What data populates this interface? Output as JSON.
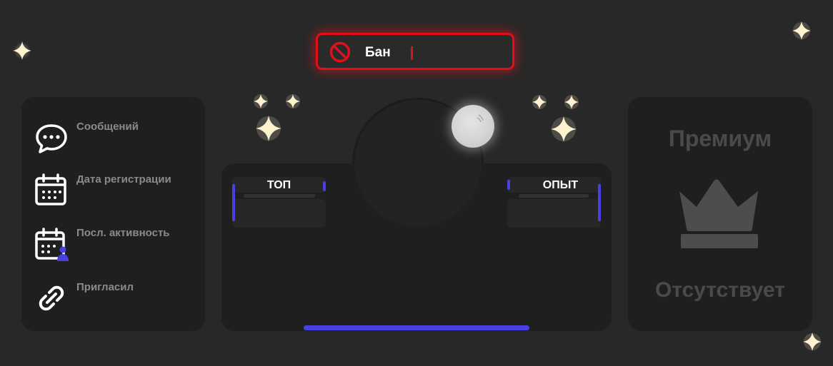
{
  "ban": {
    "label": "Бан",
    "status_color": "#e0101a"
  },
  "stats": [
    {
      "label": "Сообщений",
      "icon": "chat-bubble-icon"
    },
    {
      "label": "Дата регистрации",
      "icon": "calendar-icon"
    },
    {
      "label": "Посл. активность",
      "icon": "calendar-user-icon"
    },
    {
      "label": "Пригласил",
      "icon": "link-icon"
    }
  ],
  "profile": {
    "top_label": "ТОП",
    "xp_label": "ОПЫТ",
    "accent_color": "#4a3fe0"
  },
  "premium": {
    "title": "Премиум",
    "status": "Отсутствует",
    "icon": "crown-icon"
  }
}
